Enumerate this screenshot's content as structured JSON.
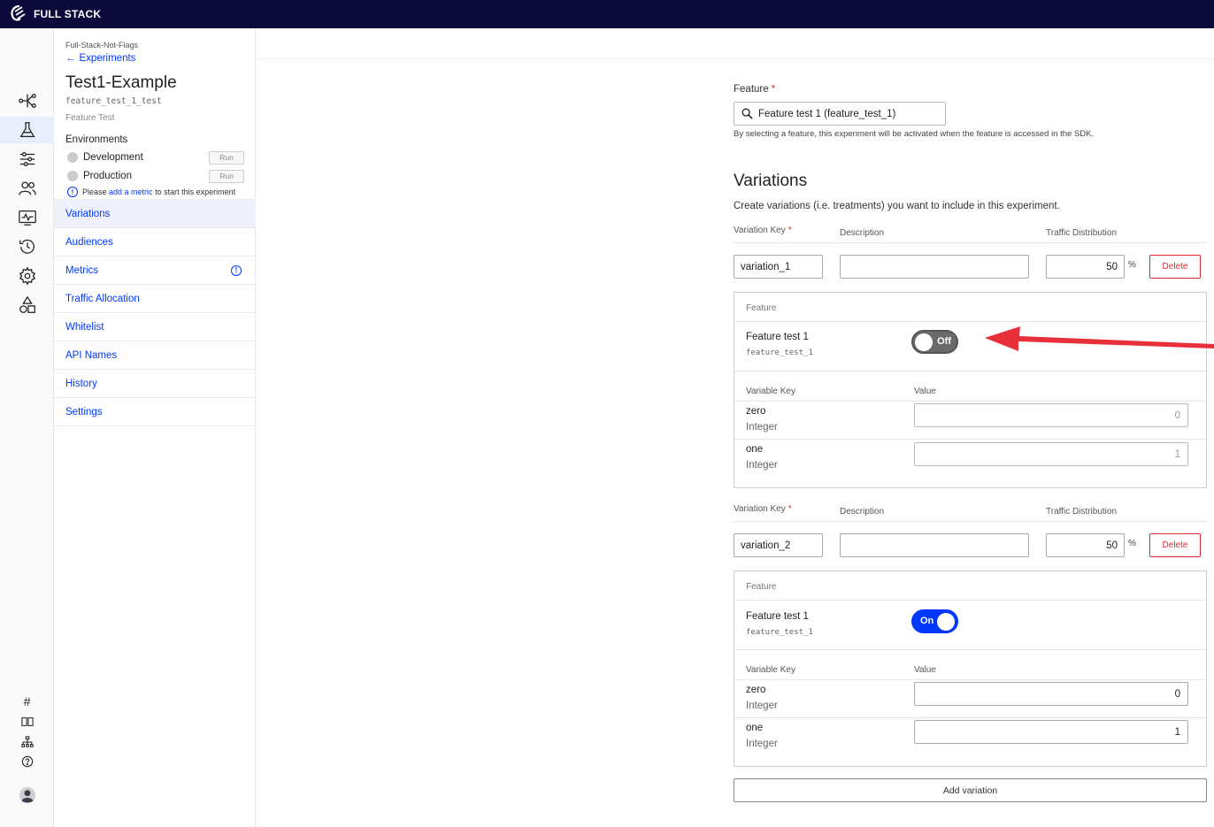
{
  "app": {
    "brand": "FULL STACK"
  },
  "rail": {
    "icons": [
      "features-icon",
      "experiments-icon",
      "settings-sliders-icon",
      "audiences-icon",
      "events-icon",
      "history-icon",
      "gear-icon",
      "shapes-icon"
    ],
    "bottom_icons": [
      "hash-icon",
      "book-icon",
      "sitemap-icon",
      "help-icon",
      "avatar"
    ]
  },
  "sidebar": {
    "project": "Full-Stack-Not-Flags",
    "back_label": "Experiments",
    "title": "Test1-Example",
    "key": "feature_test_1_test",
    "type": "Feature Test",
    "environments_heading": "Environments",
    "environments": [
      {
        "name": "Development",
        "button": "Run"
      },
      {
        "name": "Production",
        "button": "Run"
      }
    ],
    "note_prefix": "Please ",
    "note_link": "add a metric",
    "note_suffix": " to start this experiment",
    "nav": [
      "Variations",
      "Audiences",
      "Metrics",
      "Traffic Allocation",
      "Whitelist",
      "API Names",
      "History",
      "Settings"
    ]
  },
  "main": {
    "feature_label": "Feature",
    "feature_value": "Feature test 1 (feature_test_1)",
    "feature_helper": "By selecting a feature, this experiment will be activated when the feature is accessed in the SDK.",
    "variations_title": "Variations",
    "variations_desc": "Create variations (i.e. treatments) you want to include in this experiment.",
    "col_variation_key": "Variation Key",
    "col_description": "Description",
    "col_traffic": "Traffic Distribution",
    "pct_symbol": "%",
    "delete_label": "Delete",
    "panel_feature_head": "Feature",
    "panel_var_key_head": "Variable Key",
    "panel_value_head": "Value",
    "variations": [
      {
        "key": "variation_1",
        "description": "",
        "traffic": "50",
        "feature_name": "Feature test 1",
        "feature_key": "feature_test_1",
        "toggle_label": "Off",
        "variables": [
          {
            "key": "zero",
            "type": "Integer",
            "value": "0"
          },
          {
            "key": "one",
            "type": "Integer",
            "value": "1"
          }
        ]
      },
      {
        "key": "variation_2",
        "description": "",
        "traffic": "50",
        "feature_name": "Feature test 1",
        "feature_key": "feature_test_1",
        "toggle_label": "On",
        "variables": [
          {
            "key": "zero",
            "type": "Integer",
            "value": "0"
          },
          {
            "key": "one",
            "type": "Integer",
            "value": "1"
          }
        ]
      }
    ],
    "add_variation_label": "Add variation"
  },
  "colors": {
    "topbar": "#0b0a3a",
    "accent": "#0037ff",
    "danger": "#e0282e",
    "arrow": "#e8303a"
  }
}
